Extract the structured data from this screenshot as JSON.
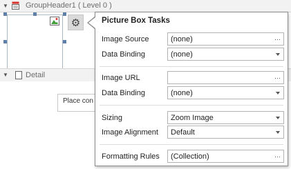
{
  "designer": {
    "group_header_title": "GroupHeader1 ( Level 0 )",
    "detail_title": "Detail",
    "placeholder_text": "Place con"
  },
  "panel": {
    "title": "Picture Box Tasks",
    "rows": {
      "image_source": {
        "label": "Image Source",
        "value": "(none)",
        "control": "ellipsis"
      },
      "data_binding_1": {
        "label": "Data Binding",
        "value": "(none)",
        "control": "dropdown"
      },
      "image_url": {
        "label": "Image URL",
        "value": "",
        "control": "ellipsis"
      },
      "data_binding_2": {
        "label": "Data Binding",
        "value": "(none)",
        "control": "dropdown"
      },
      "sizing": {
        "label": "Sizing",
        "value": "Zoom Image",
        "control": "dropdown"
      },
      "image_alignment": {
        "label": "Image Alignment",
        "value": "Default",
        "control": "dropdown"
      },
      "formatting_rules": {
        "label": "Formatting Rules",
        "value": "(Collection)",
        "control": "ellipsis"
      }
    }
  },
  "icons": {
    "smart_tag": "gear-icon",
    "ellipsis": "ellipsis-icon",
    "dropdown": "chevron-down-icon"
  },
  "colors": {
    "band_bg": "#f2f2f2",
    "panel_border": "#8c8c8c",
    "selection_handle": "#5d7fa8"
  }
}
